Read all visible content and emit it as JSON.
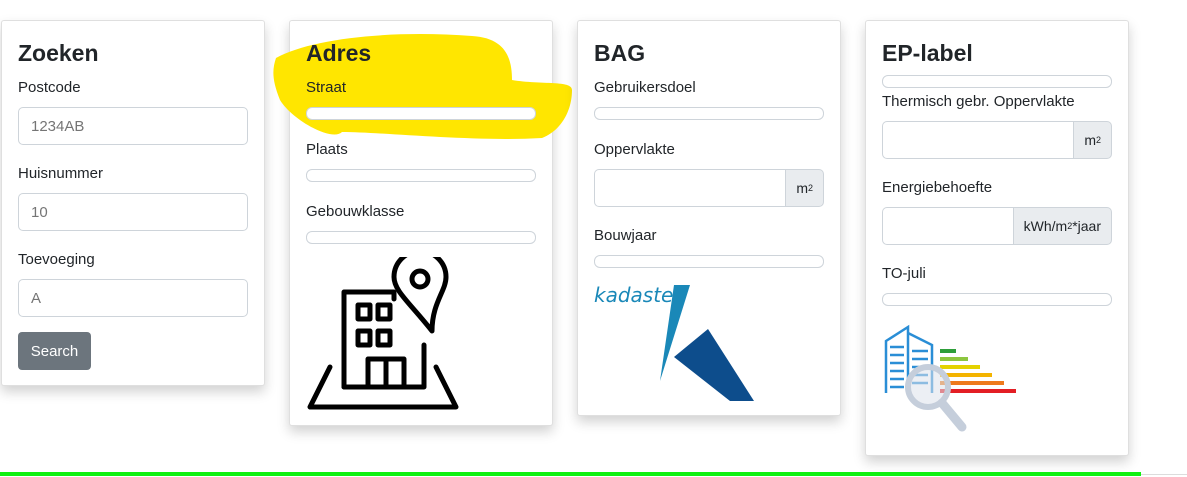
{
  "zoeken": {
    "title": "Zoeken",
    "postcode_label": "Postcode",
    "postcode_placeholder": "1234AB",
    "huisnummer_label": "Huisnummer",
    "huisnummer_placeholder": "10",
    "toevoeging_label": "Toevoeging",
    "toevoeging_placeholder": "A",
    "search_button": "Search"
  },
  "adres": {
    "title": "Adres",
    "straat_label": "Straat",
    "plaats_label": "Plaats",
    "gebouwklasse_label": "Gebouwklasse",
    "icon": "building-location-icon"
  },
  "bag": {
    "title": "BAG",
    "gebruikersdoel_label": "Gebruikersdoel",
    "oppervlakte_label": "Oppervlakte",
    "oppervlakte_unit": "m",
    "oppervlakte_unit_sup": "2",
    "bouwjaar_label": "Bouwjaar",
    "logo_text": "kadaster"
  },
  "eplabel": {
    "title": "EP-label",
    "thermisch_label": "Thermisch gebr. Oppervlakte",
    "thermisch_unit": "m",
    "thermisch_unit_sup": "2",
    "energie_label": "Energiebehoefte",
    "energie_unit_pre": "kWh/m",
    "energie_unit_sup": "2",
    "energie_unit_post": "*jaar",
    "to_juli_label": "TO-juli",
    "icon": "energy-label-building-icon"
  },
  "colors": {
    "highlight": "#ffe600",
    "button": "#6c757d",
    "progress": "#10f010",
    "kadaster_light": "#1a88b8",
    "kadaster_dark": "#0d4d8c"
  }
}
